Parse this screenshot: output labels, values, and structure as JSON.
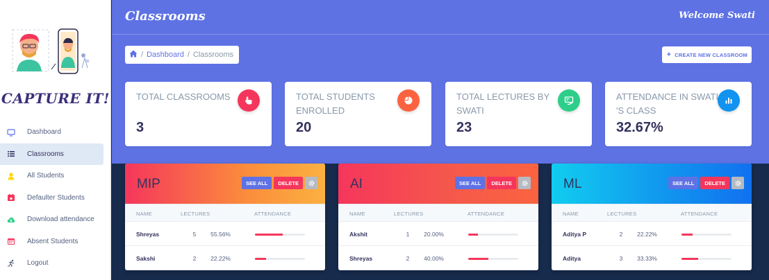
{
  "brand": {
    "name": "CAPTURE IT!"
  },
  "sidebar": {
    "items": [
      {
        "label": "Dashboard",
        "icon": "monitor-icon",
        "active": false
      },
      {
        "label": "Classrooms",
        "icon": "list-icon",
        "active": true
      },
      {
        "label": "All Students",
        "icon": "user-icon",
        "active": false
      },
      {
        "label": "Defaulter Students",
        "icon": "calendar-icon",
        "active": false
      },
      {
        "label": "Download attendance",
        "icon": "cloud-download-icon",
        "active": false
      },
      {
        "label": "Absent Students",
        "icon": "calendar-x-icon",
        "active": false
      },
      {
        "label": "Logout",
        "icon": "running-icon",
        "active": false
      }
    ]
  },
  "header": {
    "title": "Classrooms",
    "welcome": "Welcome Swati",
    "breadcrumb": {
      "home_icon": "home-icon",
      "link": "Dashboard",
      "sep": "/",
      "current": "Classrooms"
    },
    "create_button": "CREATE NEW CLASSROOM"
  },
  "stats": [
    {
      "title": "TOTAL CLASSROOMS",
      "value": "3",
      "icon": "hand-pointer-icon",
      "color": "#f5365c"
    },
    {
      "title": "TOTAL STUDENTS ENROLLED",
      "value": "20",
      "icon": "pie-chart-icon",
      "color": "#fb6340"
    },
    {
      "title": "TOTAL LECTURES BY SWATI",
      "value": "23",
      "icon": "presentation-icon",
      "color": "#2dce89"
    },
    {
      "title": "ATTENDANCE IN SWATI 'S CLASS",
      "value": "32.67%",
      "icon": "bar-chart-icon",
      "color": "#11cdef"
    }
  ],
  "classes": [
    {
      "name": "MIP",
      "gradient": [
        "#f5365c",
        "#fb8c3c",
        "#fbb140"
      ],
      "see_all": "SEE ALL",
      "delete": "DELETE",
      "headers": {
        "name": "NAME",
        "lectures": "LECTURES",
        "attendance": "ATTENDANCE"
      },
      "rows": [
        {
          "name": "Shreyas",
          "lectures": "5",
          "attendance": "55.56%",
          "fraction": 0.5556
        },
        {
          "name": "Sakshi",
          "lectures": "2",
          "attendance": "22.22%",
          "fraction": 0.2222
        }
      ]
    },
    {
      "name": "AI",
      "gradient": [
        "#f5365c",
        "#f55a4a",
        "#fb6340"
      ],
      "see_all": "SEE ALL",
      "delete": "DELETE",
      "headers": {
        "name": "NAME",
        "lectures": "LECTURES",
        "attendance": "ATTENDANCE"
      },
      "rows": [
        {
          "name": "Akshit",
          "lectures": "1",
          "attendance": "20.00%",
          "fraction": 0.2
        },
        {
          "name": "Shreyas",
          "lectures": "2",
          "attendance": "40.00%",
          "fraction": 0.4
        }
      ]
    },
    {
      "name": "ML",
      "gradient": [
        "#11cdef",
        "#1193ef",
        "#1171ef"
      ],
      "see_all": "SEE ALL",
      "delete": "DELETE",
      "headers": {
        "name": "NAME",
        "lectures": "LECTURES",
        "attendance": "ATTENDANCE"
      },
      "rows": [
        {
          "name": "Aditya P",
          "lectures": "2",
          "attendance": "22.22%",
          "fraction": 0.2222
        },
        {
          "name": "Aditya",
          "lectures": "3",
          "attendance": "33.33%",
          "fraction": 0.3333
        }
      ]
    }
  ]
}
